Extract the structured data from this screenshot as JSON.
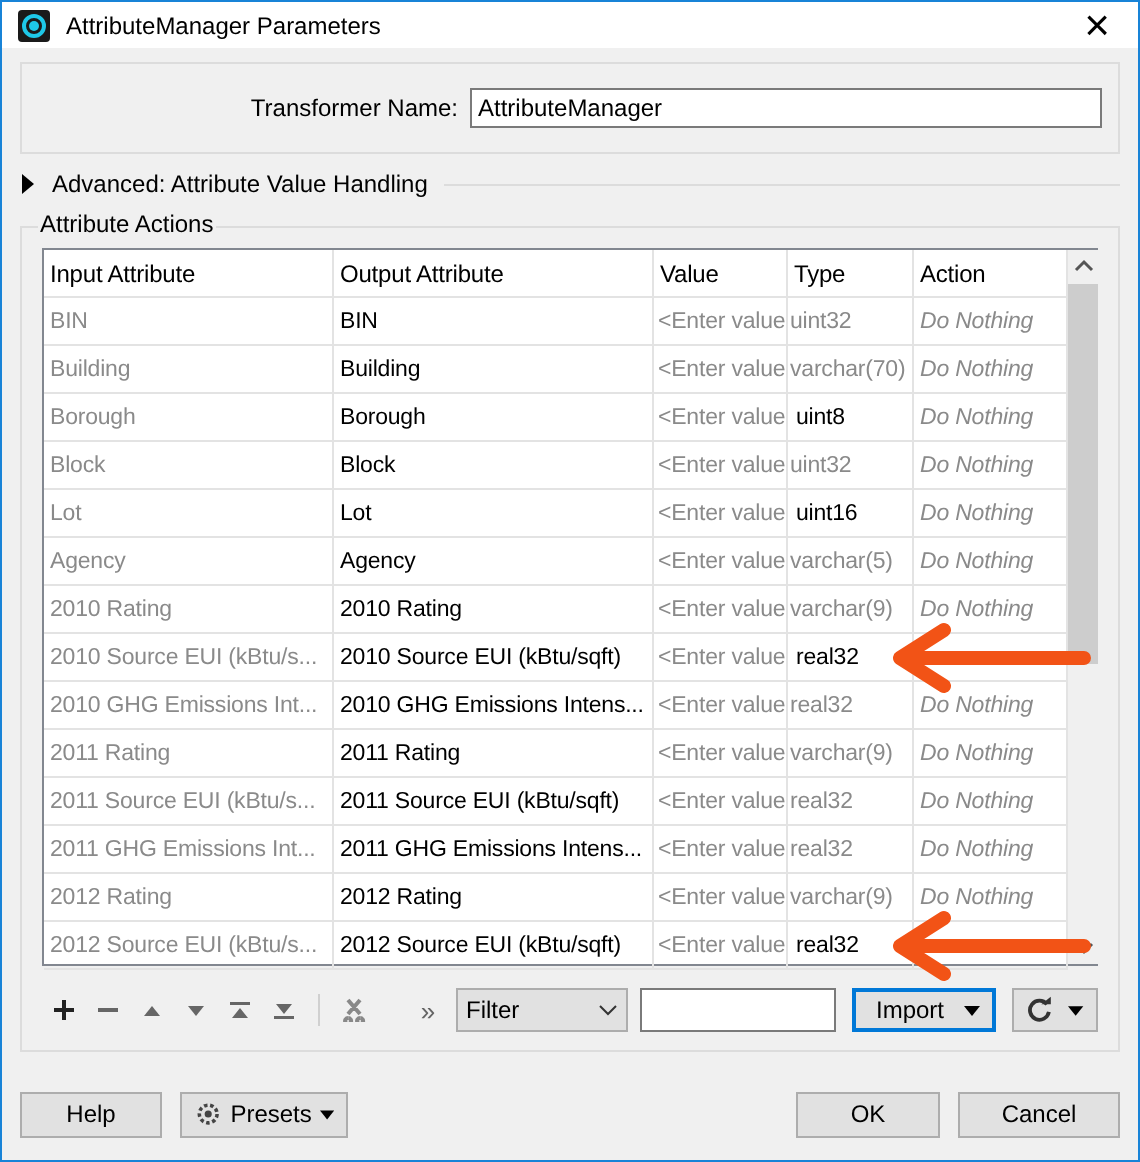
{
  "window": {
    "title": "AttributeManager Parameters",
    "close": "×"
  },
  "transformer_name": {
    "label": "Transformer Name:",
    "value": "AttributeManager"
  },
  "advanced": {
    "label": "Advanced: Attribute Value Handling",
    "expanded": false
  },
  "attribute_actions": {
    "title": "Attribute Actions",
    "columns": [
      "Input Attribute",
      "Output Attribute",
      "Value",
      "Type",
      "Action"
    ],
    "rows": [
      {
        "input": "BIN",
        "output": "BIN",
        "value": "<Enter value",
        "type": "uint32",
        "type_modified": false,
        "action": "Do Nothing",
        "arrow": false
      },
      {
        "input": "Building",
        "output": "Building",
        "value": "<Enter value",
        "type": "varchar(70)",
        "type_modified": false,
        "action": "Do Nothing",
        "arrow": false
      },
      {
        "input": "Borough",
        "output": "Borough",
        "value": "<Enter value",
        "type": "uint8",
        "type_modified": true,
        "action": "Do Nothing",
        "arrow": false
      },
      {
        "input": "Block",
        "output": "Block",
        "value": "<Enter value",
        "type": "uint32",
        "type_modified": false,
        "action": "Do Nothing",
        "arrow": false
      },
      {
        "input": "Lot",
        "output": "Lot",
        "value": "<Enter value",
        "type": "uint16",
        "type_modified": true,
        "action": "Do Nothing",
        "arrow": false
      },
      {
        "input": "Agency",
        "output": "Agency",
        "value": "<Enter value",
        "type": "varchar(5)",
        "type_modified": false,
        "action": "Do Nothing",
        "arrow": false
      },
      {
        "input": "2010 Rating",
        "output": "2010 Rating",
        "value": "<Enter value",
        "type": "varchar(9)",
        "type_modified": false,
        "action": "Do Nothing",
        "arrow": false
      },
      {
        "input": "2010 Source EUI (kBtu/s...",
        "output": "2010 Source EUI (kBtu/sqft)",
        "value": "<Enter value",
        "type": "real32",
        "type_modified": true,
        "arrow": true
      },
      {
        "input": "2010 GHG Emissions Int...",
        "output": "2010 GHG Emissions Intens...",
        "value": "<Enter value",
        "type": "real32",
        "type_modified": false,
        "action": "Do Nothing",
        "arrow": false
      },
      {
        "input": "2011 Rating",
        "output": "2011 Rating",
        "value": "<Enter value",
        "type": "varchar(9)",
        "type_modified": false,
        "action": "Do Nothing",
        "arrow": false
      },
      {
        "input": "2011 Source EUI (kBtu/s...",
        "output": "2011 Source EUI (kBtu/sqft)",
        "value": "<Enter value",
        "type": "real32",
        "type_modified": false,
        "action": "Do Nothing",
        "arrow": false
      },
      {
        "input": "2011 GHG Emissions Int...",
        "output": "2011 GHG Emissions Intens...",
        "value": "<Enter value",
        "type": "real32",
        "type_modified": false,
        "action": "Do Nothing",
        "arrow": false
      },
      {
        "input": "2012 Rating",
        "output": "2012 Rating",
        "value": "<Enter value",
        "type": "varchar(9)",
        "type_modified": false,
        "action": "Do Nothing",
        "arrow": false
      },
      {
        "input": "2012 Source EUI (kBtu/s...",
        "output": "2012 Source EUI (kBtu/sqft)",
        "value": "<Enter value",
        "type": "real32",
        "type_modified": true,
        "arrow": true
      }
    ],
    "toolbar": {
      "more": "»",
      "filter": "Filter",
      "import": "Import"
    }
  },
  "buttons": {
    "help": "Help",
    "presets": "Presets",
    "ok": "OK",
    "cancel": "Cancel"
  }
}
